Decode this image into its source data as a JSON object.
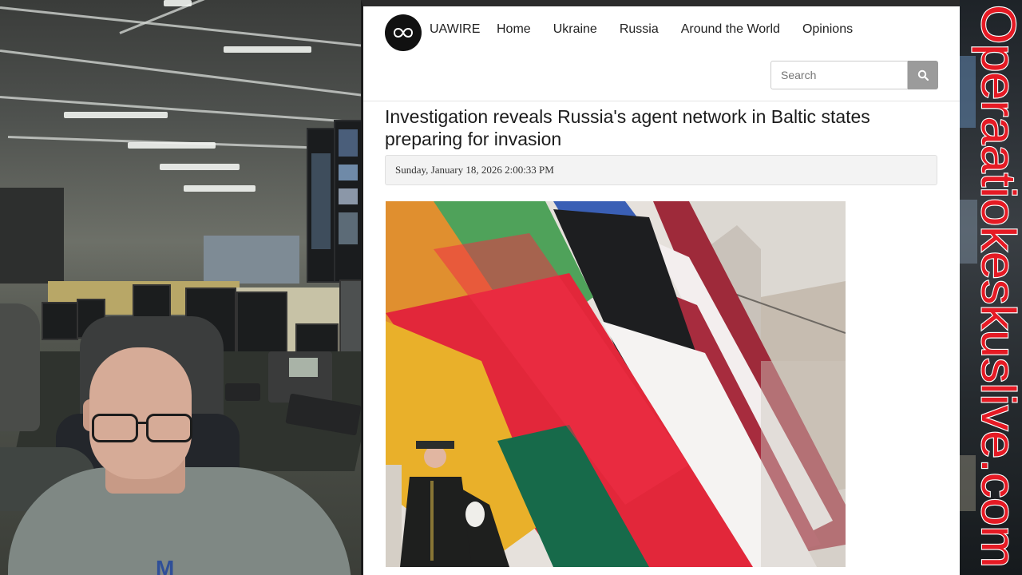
{
  "site": {
    "name": "UAWIRE",
    "nav": [
      "Home",
      "Ukraine",
      "Russia",
      "Around the World",
      "Opinions"
    ],
    "search_placeholder": "Search"
  },
  "article": {
    "headline": "Investigation reveals Russia's agent network in Baltic states preparing for invasion",
    "date": "Sunday, January 18, 2026 2:00:33 PM"
  },
  "watermark": {
    "text": "Operaatiokeskuslive.com",
    "color": "#e51a24"
  },
  "icons": {
    "logo": "infinity-icon",
    "search": "magnifier-icon"
  }
}
